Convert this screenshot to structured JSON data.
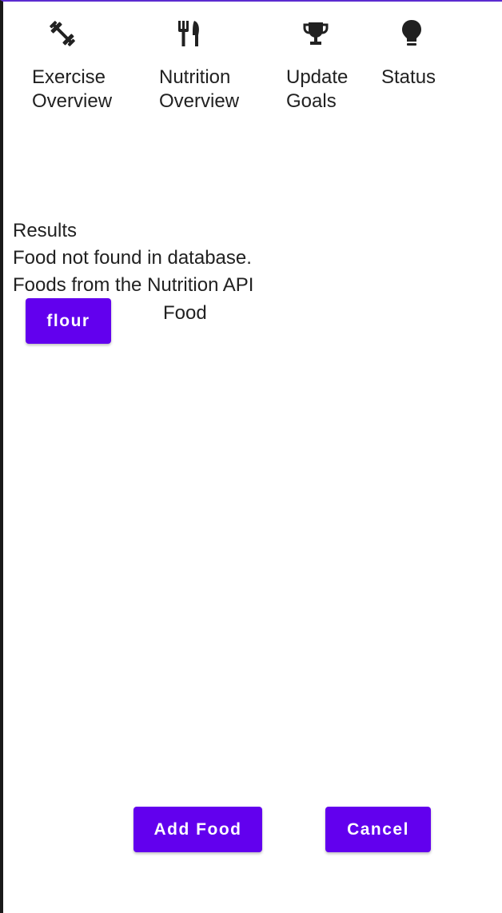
{
  "nav": {
    "items": [
      {
        "label": "Exercise\nOverview",
        "icon": "dumbbell-icon"
      },
      {
        "label": "Nutrition\nOverview",
        "icon": "fork-knife-icon"
      },
      {
        "label": "Update\nGoals",
        "icon": "trophy-icon"
      },
      {
        "label": "Status",
        "icon": "lightbulb-icon"
      }
    ]
  },
  "results": {
    "heading": "Results",
    "not_found_message": "Food not found in database.",
    "api_heading": "Foods from the Nutrition API",
    "items": [
      {
        "button_label": "flour",
        "type_label": "Food"
      }
    ]
  },
  "actions": {
    "add_food_label": "Add Food",
    "cancel_label": "Cancel"
  },
  "colors": {
    "accent": "#6200ee",
    "text": "#212121",
    "background": "#ffffff"
  }
}
